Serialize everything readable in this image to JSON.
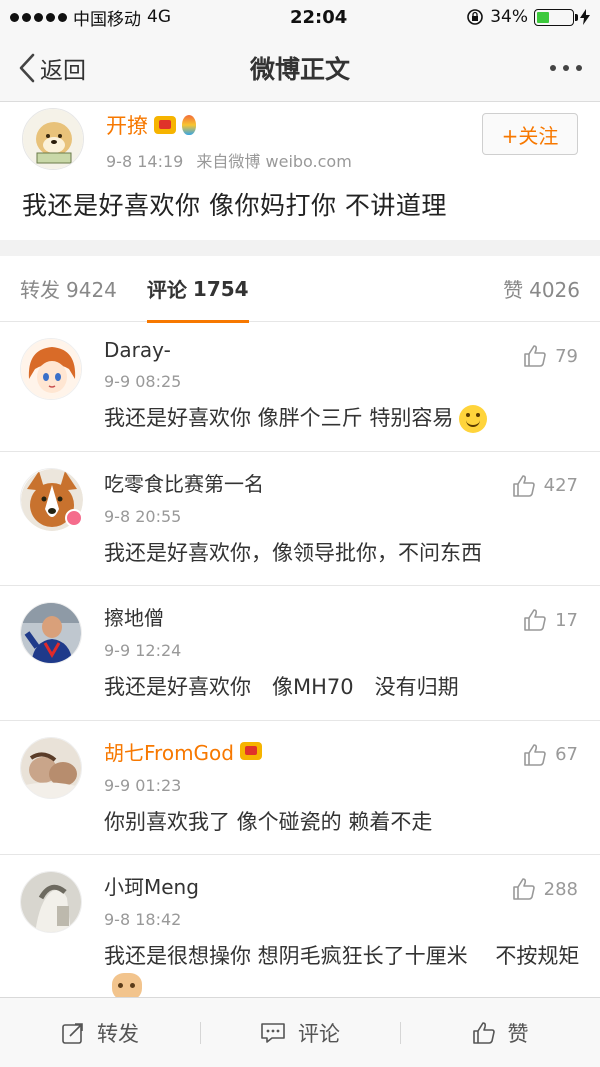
{
  "status_bar": {
    "carrier": "中国移动",
    "network": "4G",
    "time": "22:04",
    "battery_percent": "34%",
    "battery_level": 0.34,
    "battery_color": "#3cc93c"
  },
  "nav": {
    "back_label": "返回",
    "title": "微博正文"
  },
  "post": {
    "author": "开撩",
    "time": "9-8 14:19",
    "source": "来自微博 weibo.com",
    "follow_label": "+关注",
    "text": "我还是好喜欢你 像你妈打你 不讲道理"
  },
  "tabs": {
    "repost_label": "转发",
    "repost_count": "9424",
    "comment_label": "评论",
    "comment_count": "1754",
    "like_label": "赞",
    "like_count": "4026"
  },
  "comments": [
    {
      "name": "Daray-",
      "time": "9-9 08:25",
      "text": "我还是好喜欢你 像胖个三斤 特别容易",
      "likes": "79"
    },
    {
      "name": "吃零食比赛第一名",
      "time": "9-8 20:55",
      "text": "我还是好喜欢你，像领导批你，不问东西",
      "likes": "427"
    },
    {
      "name": "擦地僧",
      "time": "9-9 12:24",
      "text": "我还是好喜欢你　像MH70　没有归期",
      "likes": "17"
    },
    {
      "name": "胡七FromGod",
      "time": "9-9 01:23",
      "text": "你别喜欢我了 像个碰瓷的 赖着不走",
      "likes": "67"
    },
    {
      "name": "小珂Meng",
      "time": "9-8 18:42",
      "text": "我还是很想操你 想阴毛疯狂长了十厘米　 不按规矩",
      "likes": "288"
    }
  ],
  "bottom_bar": {
    "repost_label": "转发",
    "comment_label": "评论",
    "like_label": "赞"
  },
  "colors": {
    "accent": "#f77800"
  }
}
